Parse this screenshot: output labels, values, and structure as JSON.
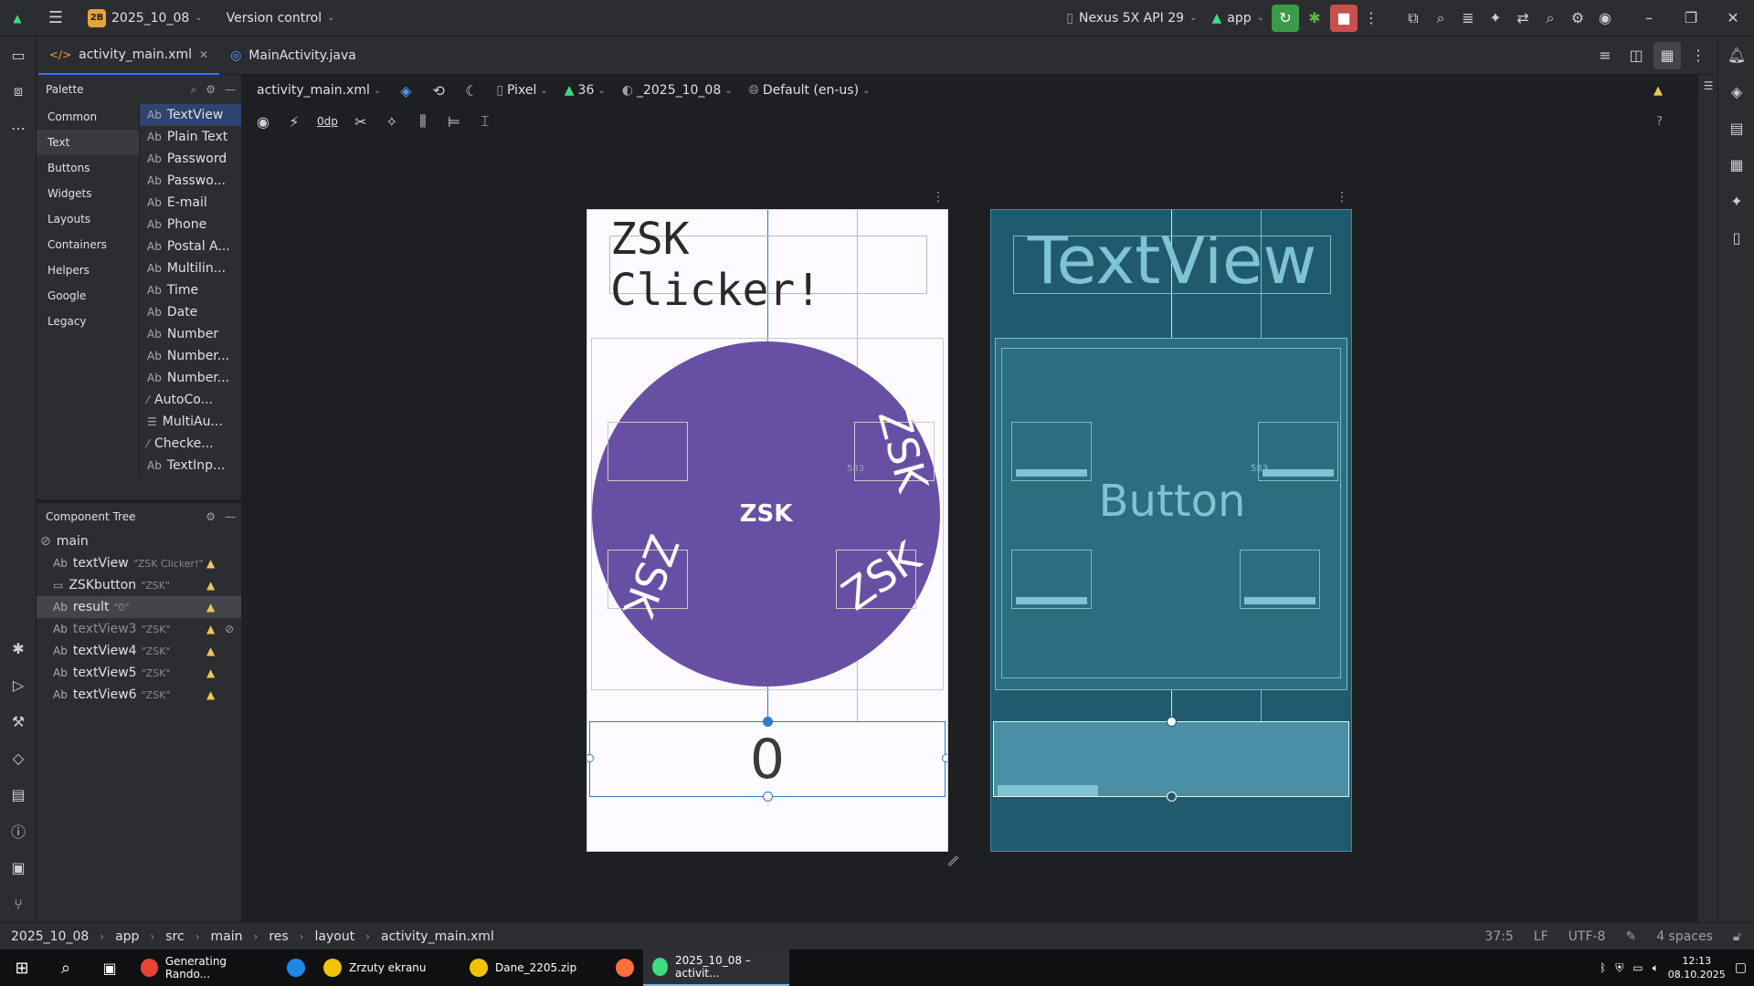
{
  "titlebar": {
    "project_badge": "2B",
    "project_name": "2025_10_08",
    "version_control": "Version control",
    "device": "Nexus 5X API 29",
    "run_config": "app"
  },
  "tabs": [
    {
      "label": "activity_main.xml",
      "active": true
    },
    {
      "label": "MainActivity.java",
      "active": false
    }
  ],
  "palette": {
    "title": "Palette",
    "categories": [
      "Common",
      "Text",
      "Buttons",
      "Widgets",
      "Layouts",
      "Containers",
      "Helpers",
      "Google",
      "Legacy"
    ],
    "selected_category": "Text",
    "items": [
      {
        "icon": "Ab",
        "label": "TextView"
      },
      {
        "icon": "Ab",
        "label": "Plain Text"
      },
      {
        "icon": "Ab",
        "label": "Password"
      },
      {
        "icon": "Ab",
        "label": "Passwo..."
      },
      {
        "icon": "Ab",
        "label": "E-mail"
      },
      {
        "icon": "Ab",
        "label": "Phone"
      },
      {
        "icon": "Ab",
        "label": "Postal A..."
      },
      {
        "icon": "Ab",
        "label": "Multilin..."
      },
      {
        "icon": "Ab",
        "label": "Time"
      },
      {
        "icon": "Ab",
        "label": "Date"
      },
      {
        "icon": "Ab",
        "label": "Number"
      },
      {
        "icon": "Ab",
        "label": "Number..."
      },
      {
        "icon": "Ab",
        "label": "Number..."
      },
      {
        "icon": "⁄",
        "label": "AutoCo..."
      },
      {
        "icon": "☰",
        "label": "MultiAu..."
      },
      {
        "icon": "⁄",
        "label": "Checke..."
      },
      {
        "icon": "Ab",
        "label": "TextInp..."
      }
    ]
  },
  "component_tree": {
    "title": "Component Tree",
    "root": "main",
    "items": [
      {
        "icon": "Ab",
        "name": "textView",
        "value": "\"ZSK Clicker!\"",
        "warn": true,
        "selected": false,
        "dim": false
      },
      {
        "icon": "▭",
        "name": "ZSKbutton",
        "value": "\"ZSK\"",
        "warn": true,
        "selected": false,
        "dim": false
      },
      {
        "icon": "Ab",
        "name": "result",
        "value": "\"0\"",
        "warn": true,
        "selected": true,
        "dim": false
      },
      {
        "icon": "Ab",
        "name": "textView3",
        "value": "\"ZSK\"",
        "warn": true,
        "selected": false,
        "dim": true,
        "hidden": true
      },
      {
        "icon": "Ab",
        "name": "textView4",
        "value": "\"ZSK\"",
        "warn": true,
        "selected": false,
        "dim": false
      },
      {
        "icon": "Ab",
        "name": "textView5",
        "value": "\"ZSK\"",
        "warn": true,
        "selected": false,
        "dim": false
      },
      {
        "icon": "Ab",
        "name": "textView6",
        "value": "\"ZSK\"",
        "warn": true,
        "selected": false,
        "dim": false
      }
    ]
  },
  "design_toolbar": {
    "file": "activity_main.xml",
    "device": "Pixel",
    "api": "36",
    "theme": "_2025_10_08",
    "locale": "Default (en-us)",
    "margin": "0dp"
  },
  "design": {
    "title_text": "ZSK Clicker!",
    "button_text": "ZSK",
    "rotated_text": "ZSK",
    "result_text": "0",
    "measure_label": "583",
    "circle_color": "#6750a4"
  },
  "blueprint": {
    "title_text": "TextView",
    "button_text": "Button",
    "measure_label": "583"
  },
  "statusbar": {
    "breadcrumbs": [
      "2025_10_08",
      "app",
      "src",
      "main",
      "res",
      "layout",
      "activity_main.xml"
    ],
    "position": "37:5",
    "line_sep": "LF",
    "encoding": "UTF-8",
    "indent": "4 spaces"
  },
  "taskbar": {
    "items": [
      {
        "label": "Generating Rando...",
        "color": "#ea4335"
      },
      {
        "label": "",
        "color": "#1e88e5"
      },
      {
        "label": "Zrzuty ekranu",
        "color": "#f2c400"
      },
      {
        "label": "Dane_2205.zip",
        "color": "#f2c400"
      },
      {
        "label": "",
        "color": "#ff7139"
      },
      {
        "label": "2025_10_08 – activit...",
        "color": "#3ddc84"
      }
    ],
    "time": "12:13",
    "date": "08.10.2025"
  }
}
